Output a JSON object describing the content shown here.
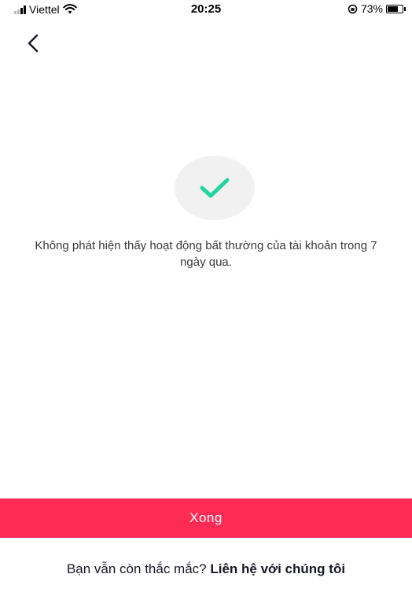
{
  "status_bar": {
    "carrier": "Viettel",
    "time": "20:25",
    "battery": "73%",
    "battery_level": 0.73,
    "icons": [
      "signal-icon",
      "wifi-icon",
      "orientation-lock-icon",
      "battery-icon"
    ]
  },
  "nav": {
    "back_icon": "chevron-left-icon"
  },
  "result": {
    "icon": "checkmark-icon",
    "message": "Không phát hiện thấy hoạt động bất thường của tài khoản trong 7 ngày qua."
  },
  "actions": {
    "done_label": "Xong"
  },
  "help": {
    "question": "Bạn vẫn còn thắc mắc? ",
    "contact_link": "Liên hệ với chúng tôi"
  },
  "colors": {
    "accent": "#fe2c55",
    "success": "#20d5a0"
  }
}
